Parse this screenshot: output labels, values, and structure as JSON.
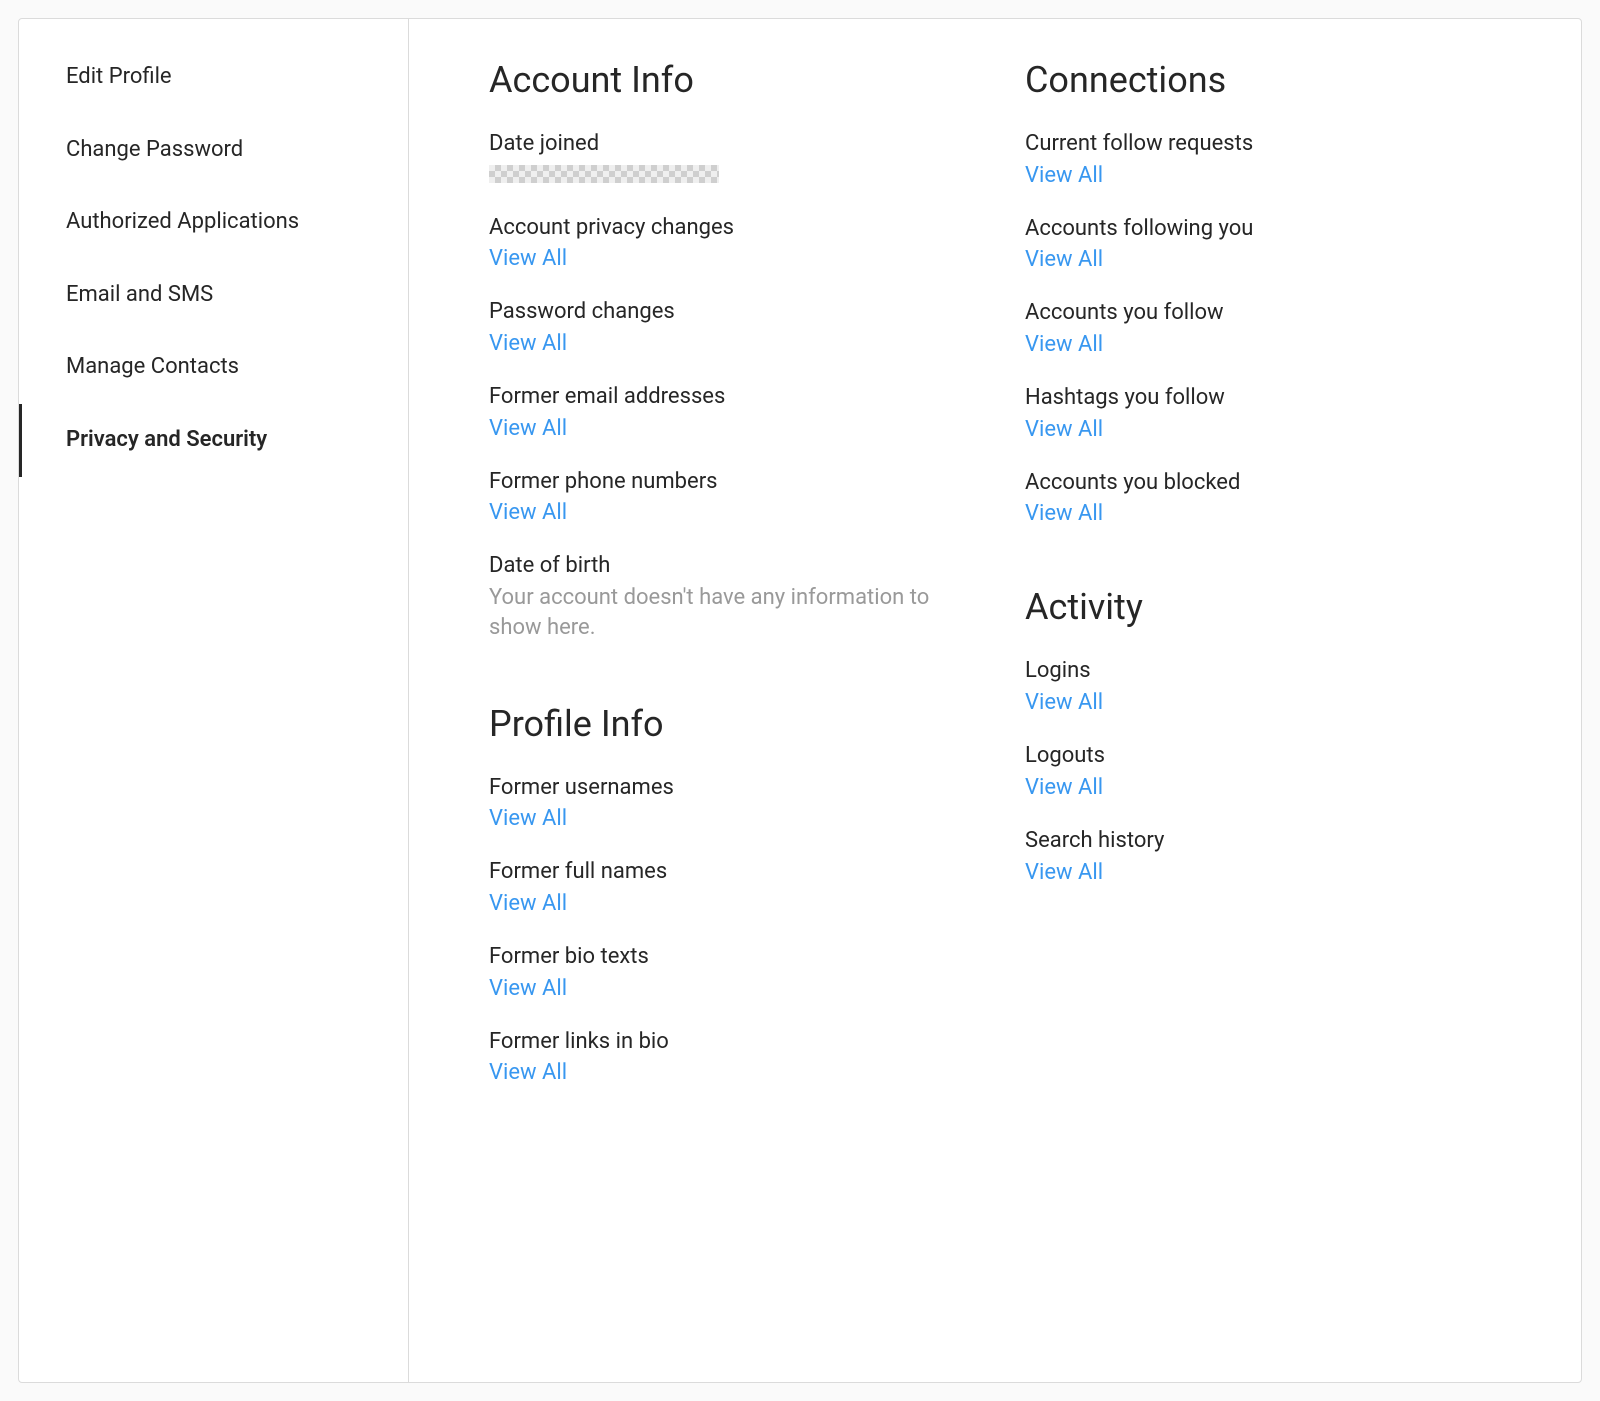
{
  "sidebar": {
    "items": [
      {
        "label": "Edit Profile",
        "active": false
      },
      {
        "label": "Change Password",
        "active": false
      },
      {
        "label": "Authorized Applications",
        "active": false
      },
      {
        "label": "Email and SMS",
        "active": false
      },
      {
        "label": "Manage Contacts",
        "active": false
      },
      {
        "label": "Privacy and Security",
        "active": true
      }
    ]
  },
  "view_all_label": "View All",
  "left_column": [
    {
      "title": "Account Info",
      "items": [
        {
          "label": "Date joined",
          "type": "redacted"
        },
        {
          "label": "Account privacy changes",
          "type": "link"
        },
        {
          "label": "Password changes",
          "type": "link"
        },
        {
          "label": "Former email addresses",
          "type": "link"
        },
        {
          "label": "Former phone numbers",
          "type": "link"
        },
        {
          "label": "Date of birth",
          "type": "empty",
          "empty_text": "Your account doesn't have any information to show here."
        }
      ]
    },
    {
      "title": "Profile Info",
      "items": [
        {
          "label": "Former usernames",
          "type": "link"
        },
        {
          "label": "Former full names",
          "type": "link"
        },
        {
          "label": "Former bio texts",
          "type": "link"
        },
        {
          "label": "Former links in bio",
          "type": "link"
        }
      ]
    }
  ],
  "right_column": [
    {
      "title": "Connections",
      "items": [
        {
          "label": "Current follow requests",
          "type": "link"
        },
        {
          "label": "Accounts following you",
          "type": "link"
        },
        {
          "label": "Accounts you follow",
          "type": "link"
        },
        {
          "label": "Hashtags you follow",
          "type": "link"
        },
        {
          "label": "Accounts you blocked",
          "type": "link"
        }
      ]
    },
    {
      "title": "Activity",
      "items": [
        {
          "label": "Logins",
          "type": "link"
        },
        {
          "label": "Logouts",
          "type": "link"
        },
        {
          "label": "Search history",
          "type": "link"
        }
      ]
    }
  ]
}
